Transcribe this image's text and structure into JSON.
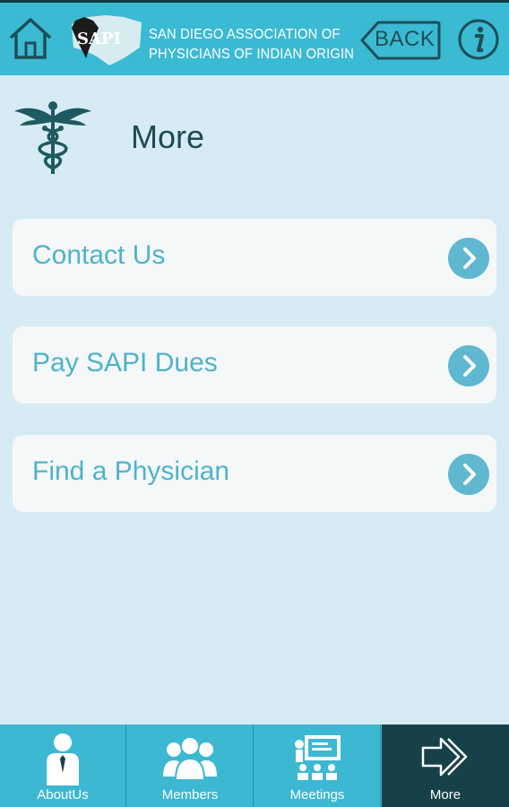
{
  "header": {
    "logo_text": "SAPI",
    "title_line1": "SAN DIEGO ASSOCIATION OF",
    "title_line2": "PHYSICIANS OF INDIAN ORIGIN",
    "back_label": "BACK",
    "home_icon": "home-icon",
    "info_icon": "info-icon"
  },
  "page": {
    "title": "More",
    "icon": "caduceus-icon"
  },
  "menu": {
    "items": [
      {
        "label": "Contact Us"
      },
      {
        "label": "Pay SAPI Dues"
      },
      {
        "label": "Find a Physician"
      }
    ]
  },
  "tabs": [
    {
      "label": "AboutUs",
      "icon": "person-icon",
      "active": false
    },
    {
      "label": "Members",
      "icon": "members-icon",
      "active": false
    },
    {
      "label": "Meetings",
      "icon": "meetings-icon",
      "active": false
    },
    {
      "label": "More",
      "icon": "arrow-right-icon",
      "active": true
    }
  ],
  "colors": {
    "header_bg": "#3bbad3",
    "page_bg": "#d6ebf3",
    "menu_text": "#4db3cc",
    "active_tab_bg": "#174148"
  }
}
